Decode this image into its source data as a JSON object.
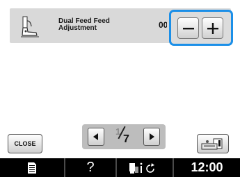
{
  "setting": {
    "label": "Dual Feed Feed Adjustment",
    "value": "00",
    "minus_label": "−",
    "plus_label": "+",
    "icon": "presser-foot-icon"
  },
  "colors": {
    "highlight": "#1b8fe8",
    "row_background": "#d9d9d9",
    "status_bar": "#000000"
  },
  "footer": {
    "close_label": "CLOSE",
    "page_current": "1",
    "page_total": "7",
    "embroidery_icon": "embroidery-unit-icon"
  },
  "status_bar": {
    "doc_icon": "document-icon",
    "help_label": "?",
    "sensor_icon": "sensor-icon",
    "time": "12:00"
  }
}
